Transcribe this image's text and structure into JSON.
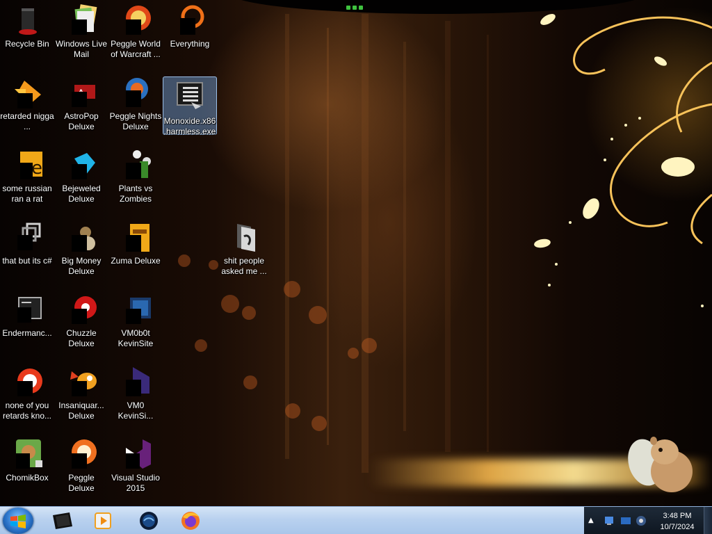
{
  "desktop": {
    "icons": [
      {
        "label": "Recycle Bin",
        "icon": "recycle-bin-icon"
      },
      {
        "label": "Windows Live Mail",
        "icon": "mail-icon"
      },
      {
        "label": "Peggle World of Warcraft ...",
        "icon": "peggle-icon"
      },
      {
        "label": "Everything",
        "icon": "search-ring-icon"
      },
      {
        "label": "retarded nigga ...",
        "icon": "app-icon"
      },
      {
        "label": "AstroPop Deluxe",
        "icon": "game-icon"
      },
      {
        "label": "Peggle Nights Deluxe",
        "icon": "peggle-icon"
      },
      {
        "label": "Monoxide.x86.harmless.exe",
        "icon": "executable-icon",
        "selected": true
      },
      {
        "label": "some russian ran a rat",
        "icon": "app-icon"
      },
      {
        "label": "Bejeweled Deluxe",
        "icon": "gem-icon"
      },
      {
        "label": "Plants vs Zombies",
        "icon": "plant-icon"
      },
      {
        "label": "that but its c#",
        "icon": "window-icon"
      },
      {
        "label": "Big Money Deluxe",
        "icon": "money-icon"
      },
      {
        "label": "Zuma Deluxe",
        "icon": "zuma-icon"
      },
      {
        "label": "shit people asked me ...",
        "icon": "folder-icon"
      },
      {
        "label": "Endermanc...",
        "icon": "window-icon"
      },
      {
        "label": "Chuzzle Deluxe",
        "icon": "chuzzle-icon"
      },
      {
        "label": "VM0b0t KevinSite",
        "icon": "vm-icon"
      },
      {
        "label": "none of you retards kno...",
        "icon": "app-icon"
      },
      {
        "label": "Insaniquar... Deluxe",
        "icon": "fish-icon"
      },
      {
        "label": "VM0 KevinSi...",
        "icon": "vm-icon"
      },
      {
        "label": "ChomikBox",
        "icon": "hamster-icon"
      },
      {
        "label": "Peggle Deluxe",
        "icon": "peggle-icon"
      },
      {
        "label": "Visual Studio 2015",
        "icon": "visual-studio-icon"
      }
    ]
  },
  "taskbar": {
    "pinned": [
      "terminal-icon",
      "media-player-icon",
      "globe-icon",
      "firefox-icon"
    ],
    "tray": {
      "show_hidden_label": "▲",
      "time": "3:48 PM",
      "date": "10/7/2024"
    }
  },
  "colors": {
    "taskbar": "#b9d1ef",
    "selection": "#78aae6",
    "accent": "#f5a623"
  }
}
